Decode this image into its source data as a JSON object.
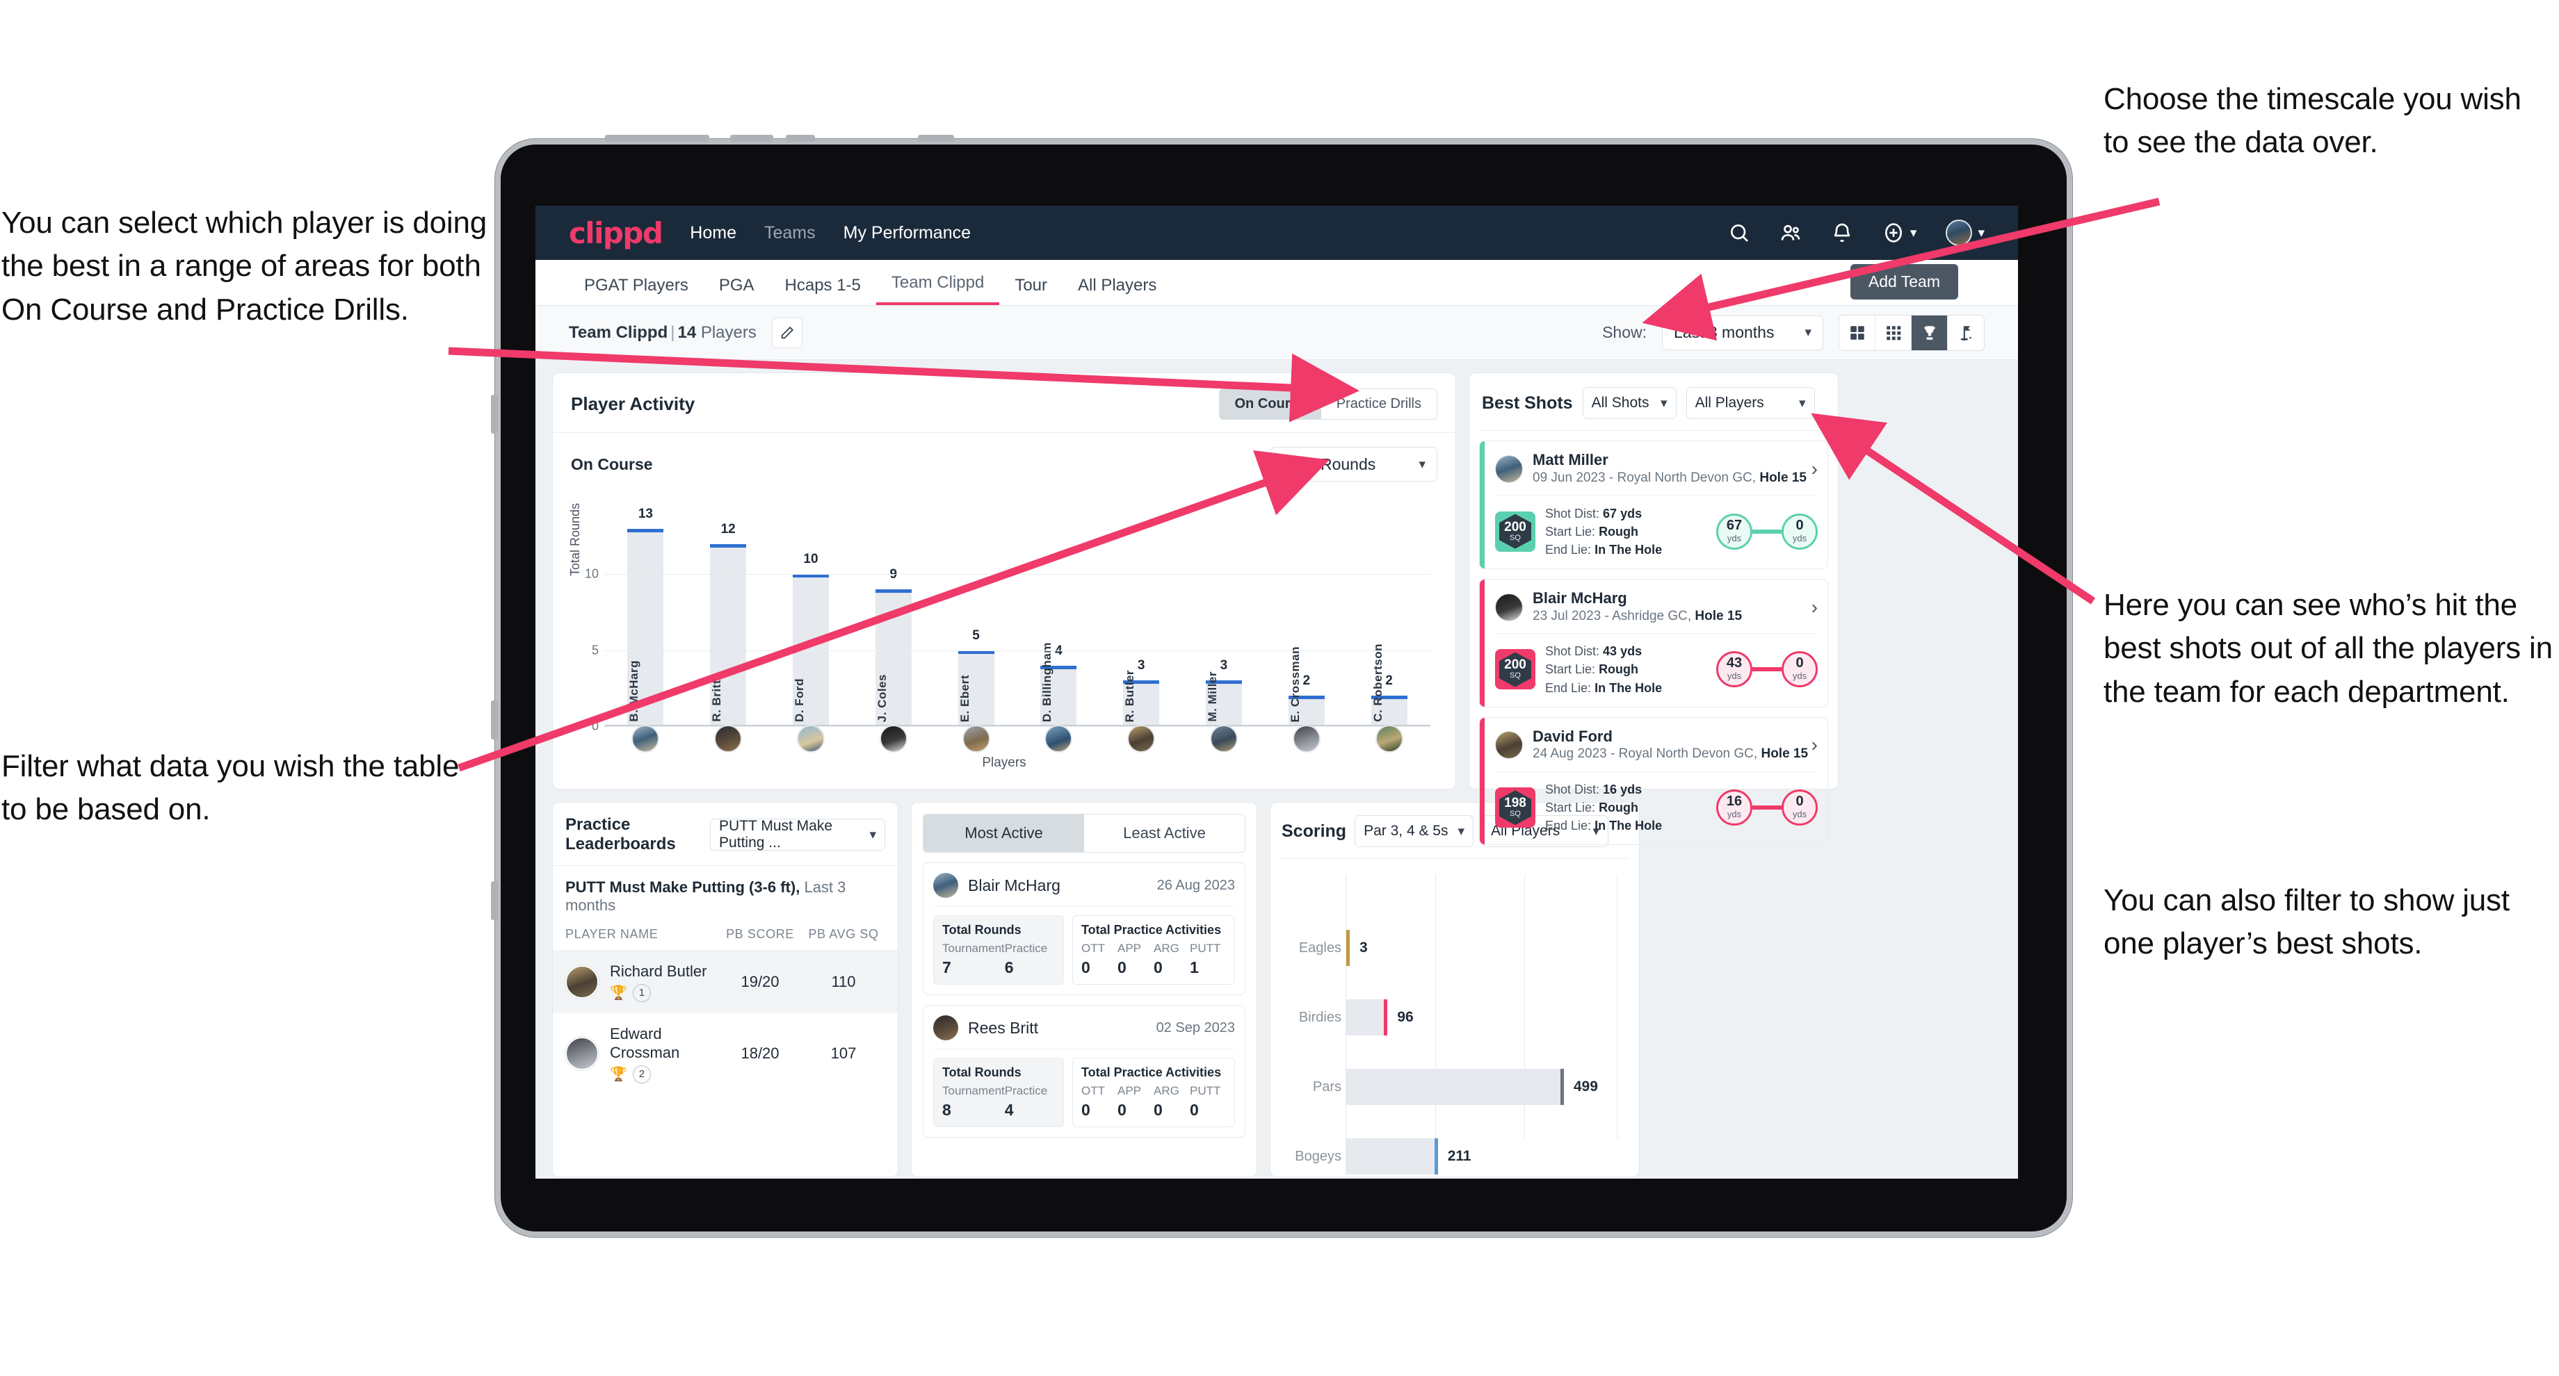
{
  "annotations": {
    "left_top": "You can select which player is doing the best in a range of areas for both On Course and Practice Drills.",
    "left_bottom": "Filter what data you wish the table to be based on.",
    "right_top": "Choose the timescale you wish to see the data over.",
    "right_mid": "Here you can see who’s hit the best shots out of all the players in the team for each department.",
    "right_bottom": "You can also filter to show just one player’s best shots.",
    "arrow_color": "#ef3a6a"
  },
  "app": {
    "brand": "clippd",
    "brand_color": "#ef3a6a",
    "topnav": [
      {
        "label": "Home",
        "active": true
      },
      {
        "label": "Teams",
        "active": false
      },
      {
        "label": "My Performance",
        "active": true
      }
    ],
    "topnav_icons": [
      "search-icon",
      "people-icon",
      "bell-icon",
      "plus-circle-icon",
      "avatar"
    ],
    "tooltip": "Add Team",
    "tabs": [
      {
        "label": "PGAT Players",
        "active": false
      },
      {
        "label": "PGA",
        "active": false
      },
      {
        "label": "Hcaps 1-5",
        "active": false
      },
      {
        "label": "Team Clippd",
        "active": true
      },
      {
        "label": "Tour",
        "active": false
      },
      {
        "label": "All Players",
        "active": false
      }
    ],
    "subbar": {
      "team_name": "Team Clippd",
      "separator": "|",
      "player_count": "14",
      "players_word": "Players",
      "edit_icon": "pencil-icon",
      "show_label": "Show:",
      "timescale_value": "Last 3 months",
      "view_toggles": [
        {
          "icon": "grid-large-icon",
          "active": false
        },
        {
          "icon": "grid-small-icon",
          "active": false
        },
        {
          "icon": "trophy-icon",
          "active": true
        },
        {
          "icon": "flag-icon",
          "active": false
        }
      ]
    }
  },
  "player_activity": {
    "title": "Player Activity",
    "segments": [
      {
        "label": "On Course",
        "active": true
      },
      {
        "label": "Practice Drills",
        "active": false
      }
    ],
    "sub_label": "On Course",
    "metric_select": "Total Rounds"
  },
  "chart_data": {
    "type": "bar",
    "title": "Player Activity",
    "xlabel": "Players",
    "ylabel": "Total Rounds",
    "ylim": [
      0,
      14
    ],
    "yticks": [
      0,
      5,
      10
    ],
    "grid": true,
    "categories": [
      "B. McHarg",
      "R. Britt",
      "D. Ford",
      "J. Coles",
      "E. Ebert",
      "D. Billingham",
      "R. Butler",
      "M. Miller",
      "E. Crossman",
      "C. Robertson"
    ],
    "values": [
      13,
      12,
      10,
      9,
      5,
      4,
      3,
      3,
      2,
      2
    ],
    "bar_color": "#e6e9ed",
    "cap_color": "#2f6fd0"
  },
  "best_shots": {
    "title": "Best Shots",
    "shot_filter": "All Shots",
    "player_filter": "All Players",
    "items": [
      {
        "name": "Matt Miller",
        "meta_date": "09 Jun 2023",
        "meta_course": "Royal North Devon GC,",
        "meta_hole": "Hole 15",
        "sq_value": "200",
        "sq_unit": "SQ",
        "accent": "#5bd0ae",
        "shot_dist_label": "Shot Dist:",
        "shot_dist": "67 yds",
        "start_lie_label": "Start Lie:",
        "start_lie": "Rough",
        "end_lie_label": "End Lie:",
        "end_lie": "In The Hole",
        "from_value": "67",
        "from_unit": "yds",
        "to_value": "0",
        "to_unit": "yds"
      },
      {
        "name": "Blair McHarg",
        "meta_date": "23 Jul 2023",
        "meta_course": "Ashridge GC,",
        "meta_hole": "Hole 15",
        "sq_value": "200",
        "sq_unit": "SQ",
        "accent": "#e8days",
        "shot_dist_label": "Shot Dist:",
        "shot_dist": "43 yds",
        "start_lie_label": "Start Lie:",
        "start_lie": "Rough",
        "end_lie_label": "End Lie:",
        "end_lie": "In The Hole",
        "from_value": "43",
        "from_unit": "yds",
        "to_value": "0",
        "to_unit": "yds"
      },
      {
        "name": "David Ford",
        "meta_date": "24 Aug 2023",
        "meta_course": "Royal North Devon GC,",
        "meta_hole": "Hole 15",
        "sq_value": "198",
        "sq_unit": "SQ",
        "accent": "#ef3a6a",
        "shot_dist_label": "Shot Dist:",
        "shot_dist": "16 yds",
        "start_lie_label": "Start Lie:",
        "start_lie": "Rough",
        "end_lie_label": "End Lie:",
        "end_lie": "In The Hole",
        "from_value": "16",
        "from_unit": "yds",
        "to_value": "0",
        "to_unit": "yds"
      }
    ]
  },
  "practice_leaderboards": {
    "title": "Practice Leaderboards",
    "drill_select": "PUTT Must Make Putting ...",
    "subtitle_bold": "PUTT Must Make Putting (3-6 ft),",
    "subtitle_light": "Last 3 months",
    "columns": [
      "PLAYER NAME",
      "PB SCORE",
      "PB AVG SQ"
    ],
    "rows": [
      {
        "name": "Richard Butler",
        "rank": "1",
        "trophy": "gold",
        "pb_score": "19/20",
        "pb_avg_sq": "110"
      },
      {
        "name": "Edward Crossman",
        "rank": "2",
        "trophy": "silver",
        "pb_score": "18/20",
        "pb_avg_sq": "107"
      }
    ]
  },
  "activity_panel": {
    "tabs": [
      {
        "label": "Most Active",
        "active": true
      },
      {
        "label": "Least Active",
        "active": false
      }
    ],
    "rounds_label": "Total Rounds",
    "practice_label": "Total Practice Activities",
    "rounds_cols": [
      "Tournament",
      "Practice"
    ],
    "practice_cols": [
      "OTT",
      "APP",
      "ARG",
      "PUTT"
    ],
    "items": [
      {
        "name": "Blair McHarg",
        "date": "26 Aug 2023",
        "rounds": [
          "7",
          "6"
        ],
        "practice": [
          "0",
          "0",
          "0",
          "1"
        ]
      },
      {
        "name": "Rees Britt",
        "date": "02 Sep 2023",
        "rounds": [
          "8",
          "4"
        ],
        "practice": [
          "0",
          "0",
          "0",
          "0"
        ]
      }
    ]
  },
  "scoring": {
    "title": "Scoring",
    "par_select": "Par 3, 4 & 5s",
    "player_select": "All Players",
    "chart": {
      "type": "bar",
      "orientation": "horizontal",
      "categories": [
        "Eagles",
        "Birdies",
        "Pars",
        "Bogeys"
      ],
      "values": [
        3,
        96,
        499,
        211
      ],
      "xmax": 620,
      "colors": [
        "#c19a3e",
        "#ef3a6a",
        "#6b7681",
        "#5b9bd5"
      ]
    }
  }
}
